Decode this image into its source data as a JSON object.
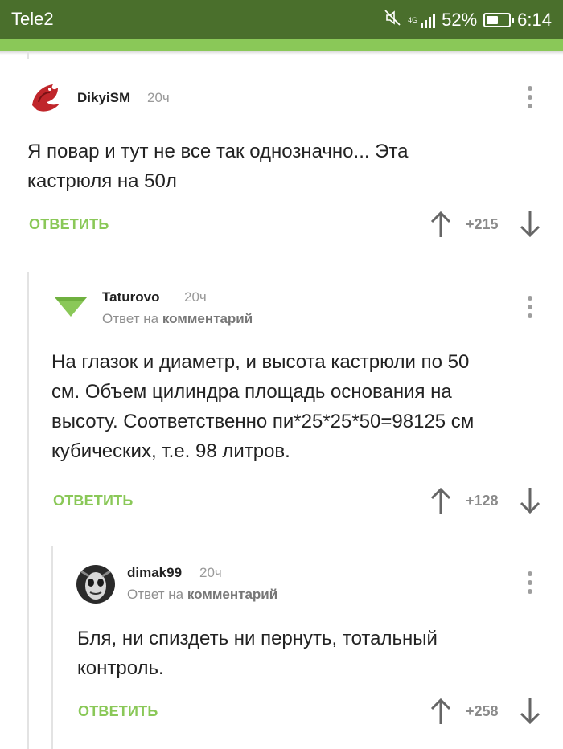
{
  "status": {
    "carrier": "Tele2",
    "network": "4G",
    "battery": "52%",
    "battery_level": 0.52,
    "time": "6:14"
  },
  "comments": [
    {
      "author": "DikyiSM",
      "time": "20ч",
      "text": [
        "Я повар и тут не все так однозначно... Эта",
        "кастрюля на 50л"
      ],
      "reply_label": "ОТВЕТИТЬ",
      "score": "+215"
    },
    {
      "author": "Taturovo",
      "time": "20ч",
      "reply_to_prefix": "Ответ на",
      "reply_to_link": "комментарий",
      "text": [
        "На глазок и диаметр, и высота кастрюли по 50",
        "см. Объем цилиндра площадь основания на",
        "высоту. Соответственно пи*25*25*50=98125 см",
        "кубических, т.е. 98 литров."
      ],
      "reply_label": "ОТВЕТИТЬ",
      "score": "+128"
    },
    {
      "author": "dimak99",
      "time": "20ч",
      "reply_to_prefix": "Ответ на",
      "reply_to_link": "комментарий",
      "text": [
        "Бля, ни спиздеть ни пернуть, тотальный",
        "контроль."
      ],
      "reply_label": "ОТВЕТИТЬ",
      "score": "+258"
    }
  ],
  "colors": {
    "statusbar": "#4a6f2c",
    "accent": "#8ac858",
    "muted": "#9a9a9a"
  },
  "icons": [
    "mute-icon",
    "signal-icon",
    "battery-icon",
    "avatar-dragon",
    "avatar-triangle",
    "avatar-mask",
    "more-vert-icon",
    "arrow-up-icon",
    "arrow-down-icon"
  ]
}
